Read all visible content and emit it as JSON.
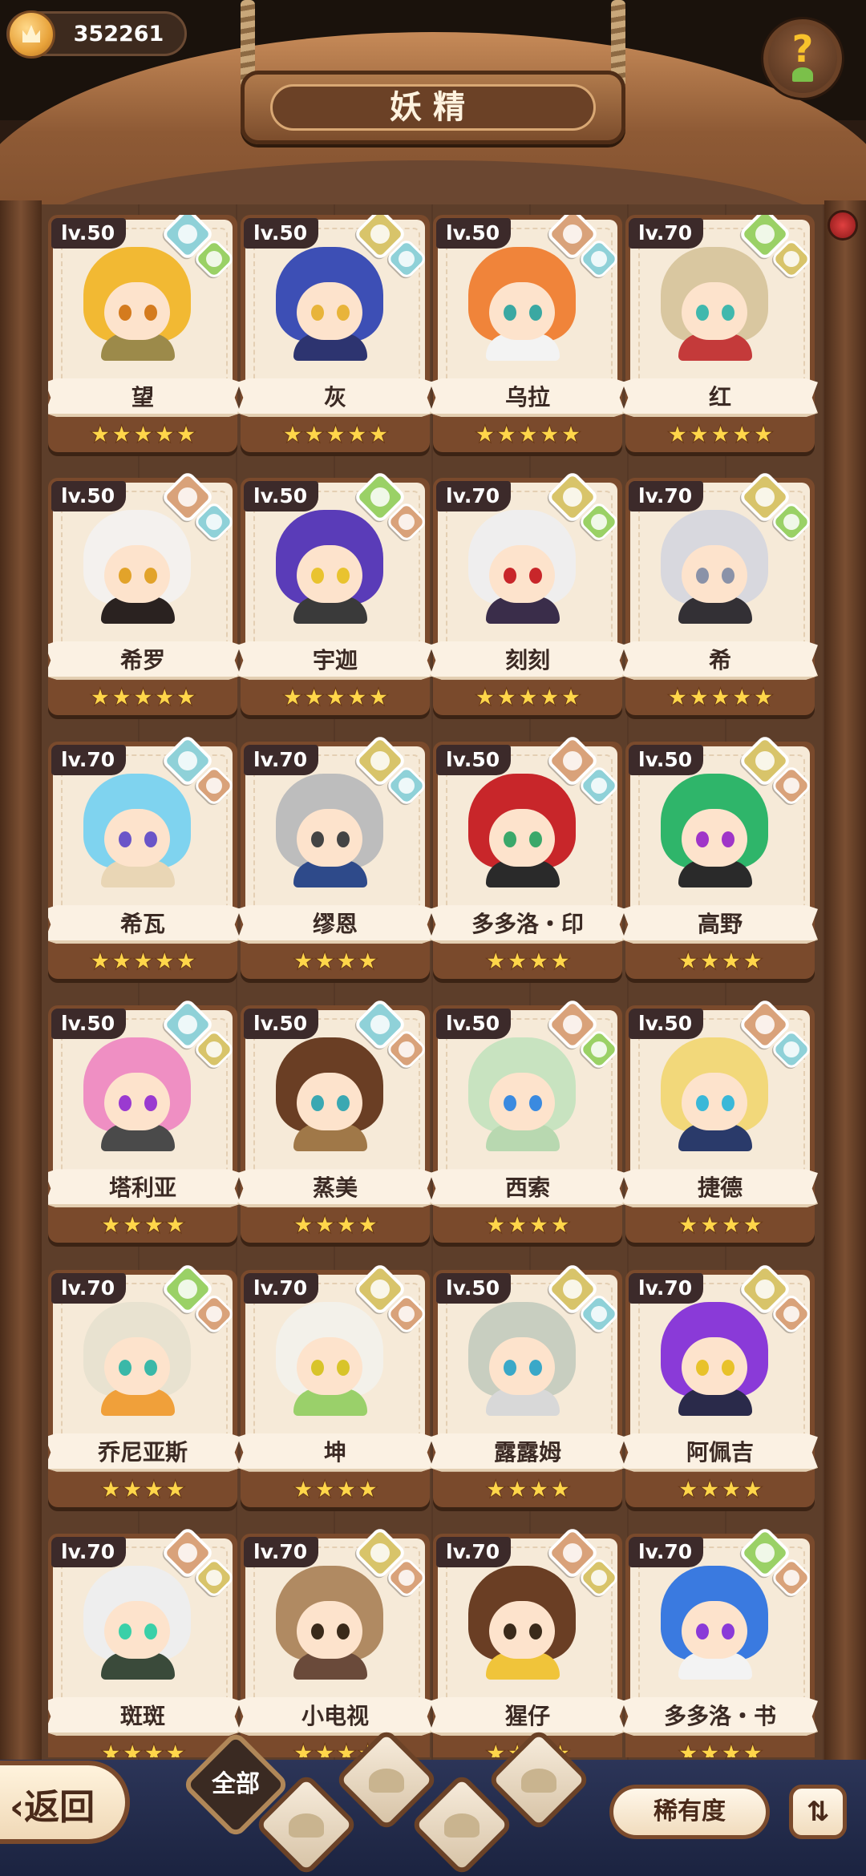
{
  "currency": {
    "amount": "352261",
    "icon": "crown-coin-icon"
  },
  "title": "妖精",
  "help": {
    "label": "?"
  },
  "colors": {
    "water": "#8fd1d8",
    "nature": "#9ad166",
    "earth": "#d8c46a",
    "mountain": "#d9a27a"
  },
  "cards": [
    {
      "level": "lv.50",
      "name": "望",
      "stars": "★★★★★",
      "el1": "water",
      "el2": "nature",
      "hair": "#f2b933",
      "eyes": "#d47b1e",
      "body": "#9c8a4a"
    },
    {
      "level": "lv.50",
      "name": "灰",
      "stars": "★★★★★",
      "el1": "earth",
      "el2": "water",
      "hair": "#3d4fb5",
      "eyes": "#e8b43a",
      "body": "#2d3470"
    },
    {
      "level": "lv.50",
      "name": "乌拉",
      "stars": "★★★★★",
      "el1": "mountain",
      "el2": "water",
      "hair": "#f0843a",
      "eyes": "#3aa8a2",
      "body": "#f3f3f3"
    },
    {
      "level": "lv.70",
      "name": "红",
      "stars": "★★★★★",
      "el1": "nature",
      "el2": "earth",
      "hair": "#d9c7a0",
      "eyes": "#40b8ad",
      "body": "#c43a3a"
    },
    {
      "level": "lv.50",
      "name": "希罗",
      "stars": "★★★★★",
      "el1": "mountain",
      "el2": "water",
      "hair": "#f4f1ee",
      "eyes": "#e2a32a",
      "body": "#2a2220"
    },
    {
      "level": "lv.50",
      "name": "宇迦",
      "stars": "★★★★★",
      "el1": "nature",
      "el2": "mountain",
      "hair": "#5a3cb8",
      "eyes": "#e9c32f",
      "body": "#3a3a3a"
    },
    {
      "level": "lv.70",
      "name": "刻刻",
      "stars": "★★★★★",
      "el1": "earth",
      "el2": "nature",
      "hair": "#efeeee",
      "eyes": "#c8262a",
      "body": "#3a2d4a"
    },
    {
      "level": "lv.70",
      "name": "希",
      "stars": "★★★★★",
      "el1": "earth",
      "el2": "nature",
      "hair": "#d8d8de",
      "eyes": "#8a92a8",
      "body": "#333035"
    },
    {
      "level": "lv.70",
      "name": "希瓦",
      "stars": "★★★★★",
      "el1": "water",
      "el2": "mountain",
      "hair": "#7fd3ef",
      "eyes": "#6a55c8",
      "body": "#e9d6b5"
    },
    {
      "level": "lv.70",
      "name": "缪恩",
      "stars": "★★★★",
      "el1": "earth",
      "el2": "water",
      "hair": "#bdbdbd",
      "eyes": "#444444",
      "body": "#2e4a8a"
    },
    {
      "level": "lv.50",
      "name": "多多洛・印",
      "stars": "★★★★",
      "el1": "mountain",
      "el2": "water",
      "hair": "#c8262a",
      "eyes": "#3aa86a",
      "body": "#2a2a2a"
    },
    {
      "level": "lv.50",
      "name": "高野",
      "stars": "★★★★",
      "el1": "earth",
      "el2": "mountain",
      "hair": "#2fb56a",
      "eyes": "#a035c8",
      "body": "#2a2a2a"
    },
    {
      "level": "lv.50",
      "name": "塔利亚",
      "stars": "★★★★",
      "el1": "water",
      "el2": "earth",
      "hair": "#ef8fc3",
      "eyes": "#9a3ad0",
      "body": "#4a4a4a"
    },
    {
      "level": "lv.50",
      "name": "蒸美",
      "stars": "★★★★",
      "el1": "water",
      "el2": "mountain",
      "hair": "#6a3e24",
      "eyes": "#3aa8b2",
      "body": "#a07848"
    },
    {
      "level": "lv.50",
      "name": "西索",
      "stars": "★★★★",
      "el1": "mountain",
      "el2": "nature",
      "hair": "#c8e3c0",
      "eyes": "#3a8ae0",
      "body": "#b8d8b0"
    },
    {
      "level": "lv.50",
      "name": "捷德",
      "stars": "★★★★",
      "el1": "mountain",
      "el2": "water",
      "hair": "#f2d87a",
      "eyes": "#3ab8d8",
      "body": "#2a3a6a"
    },
    {
      "level": "lv.70",
      "name": "乔尼亚斯",
      "stars": "★★★★",
      "el1": "nature",
      "el2": "mountain",
      "hair": "#e8e2d0",
      "eyes": "#3ab8a8",
      "body": "#f0a03a"
    },
    {
      "level": "lv.70",
      "name": "坤",
      "stars": "★★★★",
      "el1": "earth",
      "el2": "mountain",
      "hair": "#f3f1ea",
      "eyes": "#d8c42a",
      "body": "#9ad06a"
    },
    {
      "level": "lv.50",
      "name": "露露姆",
      "stars": "★★★★",
      "el1": "earth",
      "el2": "water",
      "hair": "#c8cec0",
      "eyes": "#3aa8c8",
      "body": "#d8d8d8"
    },
    {
      "level": "lv.70",
      "name": "阿佩吉",
      "stars": "★★★★",
      "el1": "earth",
      "el2": "mountain",
      "hair": "#8a3ad8",
      "eyes": "#e8c22a",
      "body": "#2a2a4a"
    },
    {
      "level": "lv.70",
      "name": "斑斑",
      "stars": "★★★★",
      "el1": "mountain",
      "el2": "earth",
      "hair": "#eeeeee",
      "eyes": "#3ad0a8",
      "body": "#3a4a3a"
    },
    {
      "level": "lv.70",
      "name": "小电视",
      "stars": "★★★★",
      "el1": "earth",
      "el2": "mountain",
      "hair": "#b08a62",
      "eyes": "#3a2a1a",
      "body": "#6a4a3a"
    },
    {
      "level": "lv.70",
      "name": "猩仔",
      "stars": "★★★★",
      "el1": "mountain",
      "el2": "earth",
      "hair": "#6a3e24",
      "eyes": "#3a2a1a",
      "body": "#f0c43a"
    },
    {
      "level": "lv.70",
      "name": "多多洛・书",
      "stars": "★★★★",
      "el1": "nature",
      "el2": "mountain",
      "hair": "#3a7ae0",
      "eyes": "#8a3ad8",
      "body": "#f3f3f3"
    }
  ],
  "bottom": {
    "back_label": "‹返回",
    "filter_all_label": "全部",
    "rarity_label": "稀有度",
    "sort_label": "⇅"
  }
}
